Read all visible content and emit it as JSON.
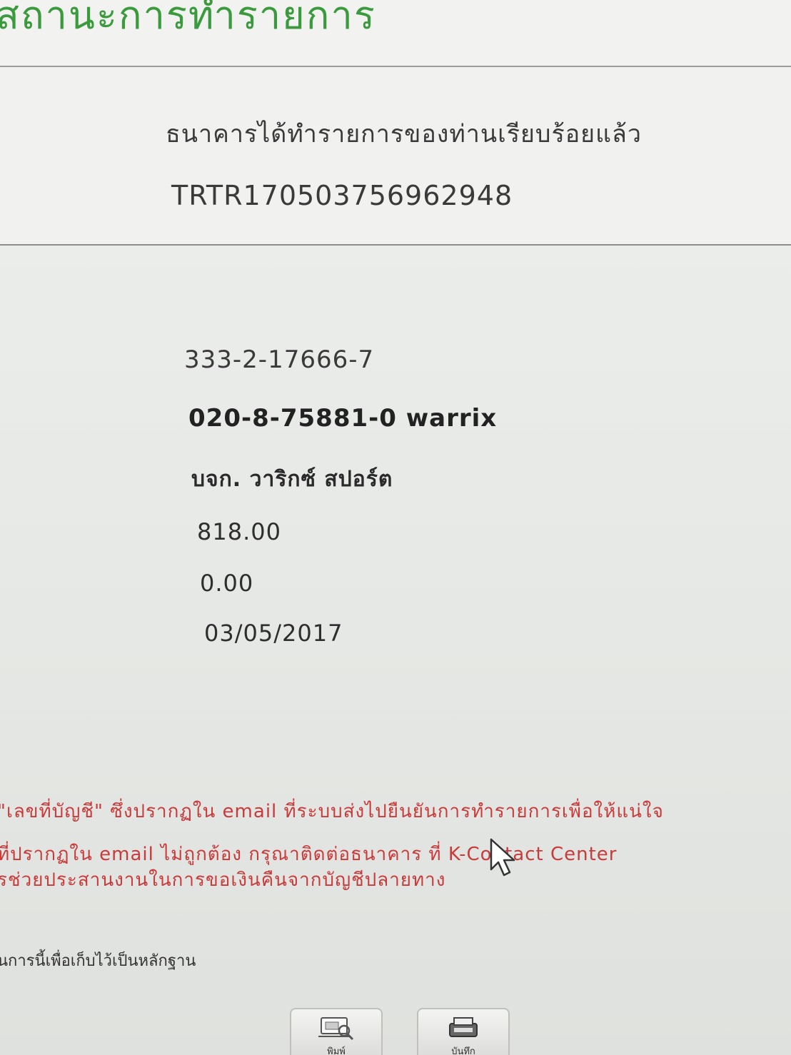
{
  "header": {
    "title": "สถานะการทำรายการ"
  },
  "result": {
    "message": "ธนาคารได้ทำรายการของท่านเรียบร้อยแล้ว",
    "reference_no": "TRTR17050375696294​8"
  },
  "details": {
    "from_account": "333-2-17666-7",
    "to_account": "020-8-75881-0 warrix",
    "to_account_name": "บจก. วาริกซ์ สปอร์ต",
    "amount": "818.00",
    "fee": "0.00",
    "date": "03/05/2017"
  },
  "warnings": {
    "line1": "\"เลขที่บัญชี\" ซึ่งปรากฏใน email ที่ระบบส่งไปยืนยันการทำรายการเพื่อให้แน่ใจ",
    "line2": "ที่ปรากฏใน email ไม่ถูกต้อง กรุณาติดต่อธนาคาร ที่ K-Contact Center",
    "line3": "รช่วยประสานงานในการขอเงินคืนจากบัญชีปลายทาง"
  },
  "save_note": "นการนี้เพื่อเก็บไว้เป็นหลักฐาน",
  "buttons": {
    "print_label": "พิมพ์",
    "save_label": "บันทึก",
    "print_icon": "printer-icon",
    "save_icon": "save-icon"
  },
  "colors": {
    "title_green": "#3b9a3e",
    "warning_red": "#c93a3a"
  }
}
